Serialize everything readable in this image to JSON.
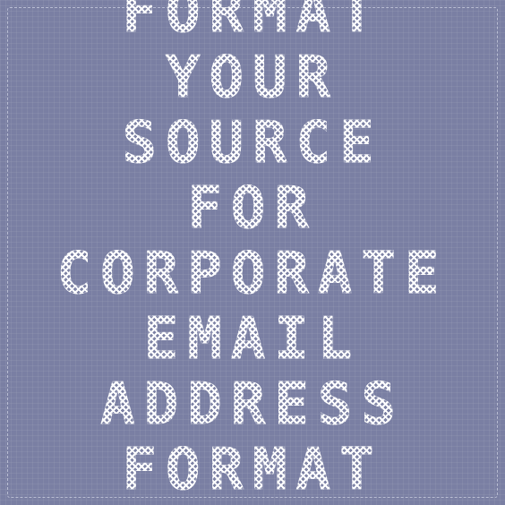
{
  "background": {
    "color": "#7a7fa3",
    "stitch_color": "#ffffff"
  },
  "lines": [
    "FORMAT",
    "YOUR",
    "SOURCE",
    "FOR",
    "CORPORATE",
    "EMAIL",
    "ADDRESS",
    "FORMAT"
  ]
}
